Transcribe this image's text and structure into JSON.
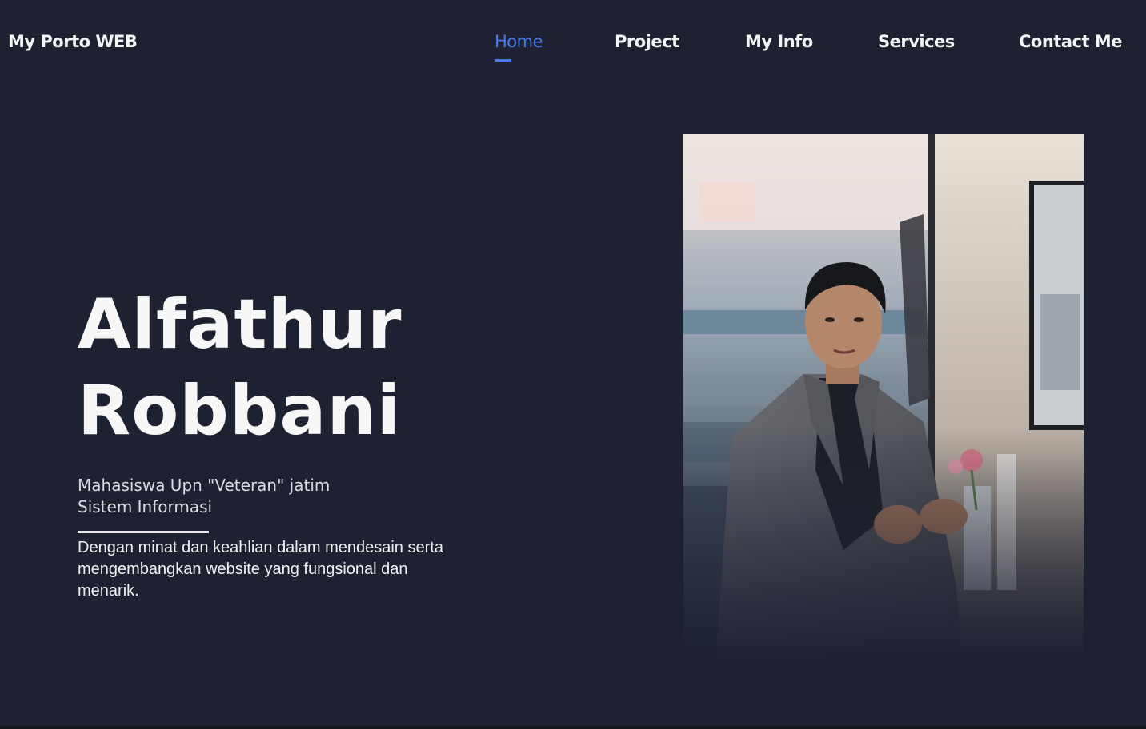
{
  "header": {
    "brand": "My Porto WEB",
    "nav": [
      {
        "label": "Home",
        "active": true
      },
      {
        "label": "Project",
        "active": false
      },
      {
        "label": "My Info",
        "active": false
      },
      {
        "label": "Services",
        "active": false
      },
      {
        "label": "Contact Me",
        "active": false
      }
    ]
  },
  "hero": {
    "name_line1": "Alfathur",
    "name_line2": "Robbani",
    "subtitle_line1": "Mahasiswa Upn \"Veteran\" jatim",
    "subtitle_line2": "Sistem Informasi",
    "description": "Dengan minat dan keahlian dalam mendesain serta mengembangkan website yang fungsional dan menarik."
  },
  "colors": {
    "background": "#1d2132",
    "accent": "#4a7be8",
    "text": "#f4f4f6"
  }
}
